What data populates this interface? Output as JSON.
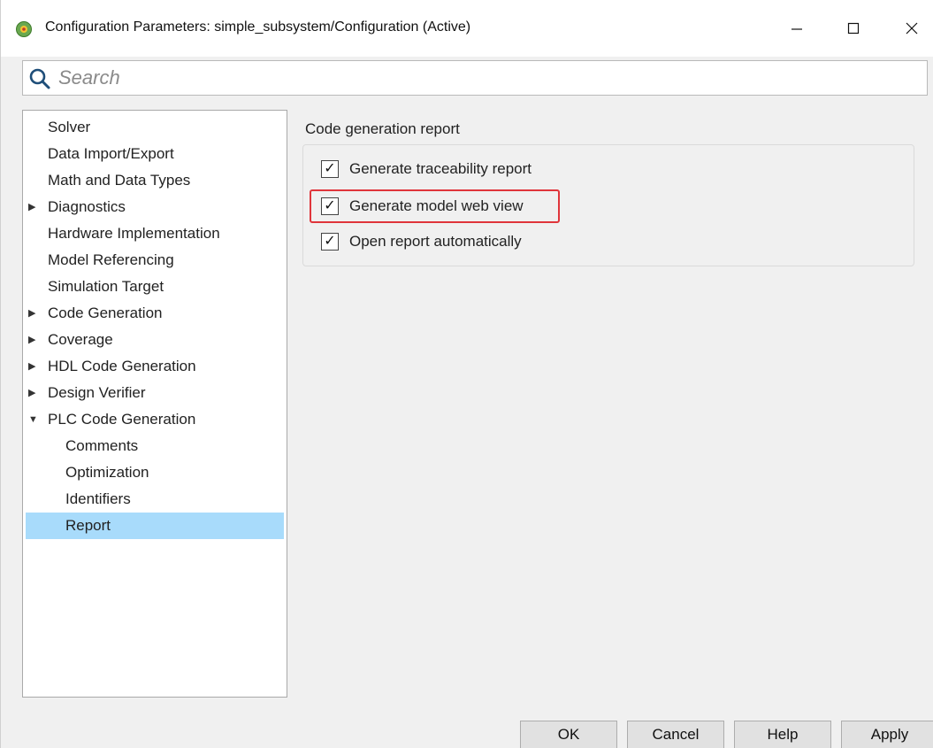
{
  "window": {
    "title": "Configuration Parameters: simple_subsystem/Configuration (Active)",
    "icon": "simulink-config-icon",
    "controls": {
      "minimize": "—",
      "maximize": "☐",
      "close": "✕"
    }
  },
  "search": {
    "placeholder": "Search",
    "value": ""
  },
  "tree": {
    "items": [
      {
        "label": "Solver",
        "level": 0,
        "expandable": false,
        "expanded": false,
        "selected": false
      },
      {
        "label": "Data Import/Export",
        "level": 0,
        "expandable": false,
        "expanded": false,
        "selected": false
      },
      {
        "label": "Math and Data Types",
        "level": 0,
        "expandable": false,
        "expanded": false,
        "selected": false
      },
      {
        "label": "Diagnostics",
        "level": 0,
        "expandable": true,
        "expanded": false,
        "selected": false
      },
      {
        "label": "Hardware Implementation",
        "level": 0,
        "expandable": false,
        "expanded": false,
        "selected": false
      },
      {
        "label": "Model Referencing",
        "level": 0,
        "expandable": false,
        "expanded": false,
        "selected": false
      },
      {
        "label": "Simulation Target",
        "level": 0,
        "expandable": false,
        "expanded": false,
        "selected": false
      },
      {
        "label": "Code Generation",
        "level": 0,
        "expandable": true,
        "expanded": false,
        "selected": false
      },
      {
        "label": "Coverage",
        "level": 0,
        "expandable": true,
        "expanded": false,
        "selected": false
      },
      {
        "label": "HDL Code Generation",
        "level": 0,
        "expandable": true,
        "expanded": false,
        "selected": false
      },
      {
        "label": "Design Verifier",
        "level": 0,
        "expandable": true,
        "expanded": false,
        "selected": false
      },
      {
        "label": "PLC Code Generation",
        "level": 0,
        "expandable": true,
        "expanded": true,
        "selected": false
      },
      {
        "label": "Comments",
        "level": 1,
        "expandable": false,
        "expanded": false,
        "selected": false
      },
      {
        "label": "Optimization",
        "level": 1,
        "expandable": false,
        "expanded": false,
        "selected": false
      },
      {
        "label": "Identifiers",
        "level": 1,
        "expandable": false,
        "expanded": false,
        "selected": false
      },
      {
        "label": "Report",
        "level": 1,
        "expandable": false,
        "expanded": false,
        "selected": true
      }
    ]
  },
  "panel": {
    "section_title": "Code generation report",
    "options": [
      {
        "label": "Generate traceability report",
        "checked": true,
        "highlighted": false
      },
      {
        "label": "Generate model web view",
        "checked": true,
        "highlighted": true
      },
      {
        "label": "Open report automatically",
        "checked": true,
        "highlighted": false
      }
    ]
  },
  "buttons": {
    "ok": "OK",
    "cancel": "Cancel",
    "help": "Help",
    "apply": "Apply"
  },
  "colors": {
    "selection": "#a8dbfb",
    "highlight_border": "#e0353b",
    "window_bg": "#f0f0f0"
  }
}
